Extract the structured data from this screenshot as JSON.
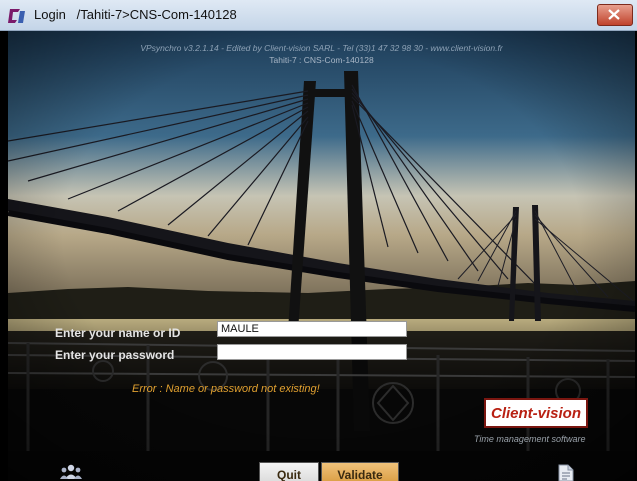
{
  "window": {
    "title_label": "Login",
    "title_path": "/Tahiti-7>CNS-Com-140128"
  },
  "header": {
    "credit_line": "VPsynchro v3.2.1.14 - Edited by Client-vision SARL - Tel (33)1 47 32 98 30 - www.client-vision.fr",
    "server_line": "Tahiti-7 : CNS-Com-140128"
  },
  "form": {
    "name_label": "Enter your name or ID",
    "name_value": "MAULE",
    "password_label": "Enter your password",
    "password_value": "",
    "error_message": "Error : Name or password not existing!"
  },
  "brand": {
    "logo_text": "Client-vision",
    "tagline": "Time management software"
  },
  "buttons": {
    "quit_label": "Quit",
    "validate_label": "Validate"
  },
  "icons": {
    "app": "app-logo-icon",
    "close": "close-icon",
    "users": "users-icon",
    "document": "document-icon"
  },
  "colors": {
    "error": "#e0a030",
    "logo_red": "#b82012",
    "validate_bg": "#d89a3e"
  }
}
